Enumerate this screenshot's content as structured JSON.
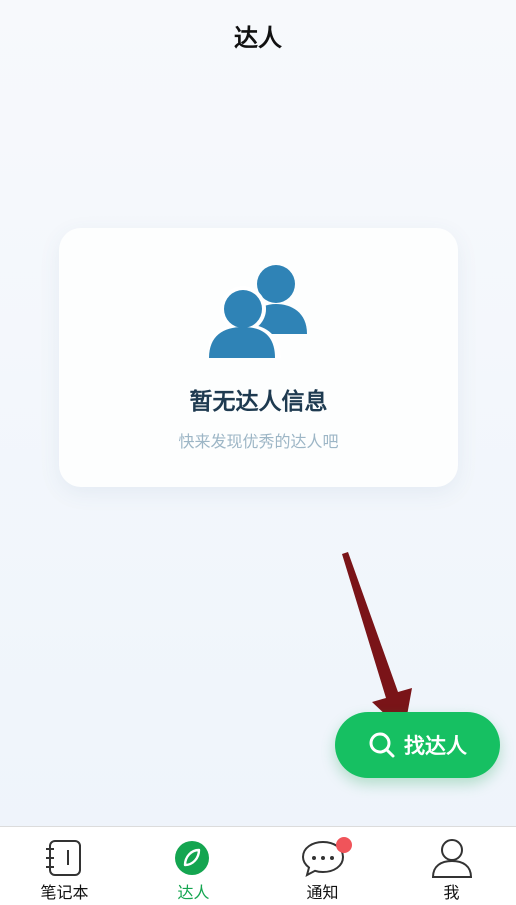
{
  "header": {
    "title": "达人"
  },
  "empty_state": {
    "icon": "people-icon",
    "title": "暂无达人信息",
    "subtitle": "快来发现优秀的达人吧"
  },
  "find_button": {
    "label": "找达人",
    "icon": "search-icon",
    "color": "#16c062"
  },
  "tabs": [
    {
      "label": "笔记本",
      "icon": "notebook-icon",
      "active": false
    },
    {
      "label": "达人",
      "icon": "compass-icon",
      "active": true
    },
    {
      "label": "通知",
      "icon": "chat-bubble-icon",
      "active": false,
      "has_badge": true
    },
    {
      "label": "我",
      "icon": "person-icon",
      "active": false
    }
  ],
  "colors": {
    "accent": "#16c062",
    "icon_blue": "#2f83b6",
    "title_dark": "#1e3a50",
    "subtitle_gray": "#9db6c6",
    "badge_red": "#f0545a",
    "annotation_arrow": "#7a1418"
  }
}
